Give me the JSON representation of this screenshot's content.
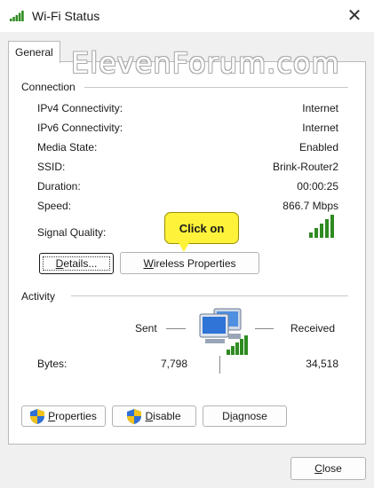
{
  "window": {
    "title": "Wi-Fi Status",
    "close_glyph": "✕"
  },
  "tabs": [
    {
      "label": "General"
    }
  ],
  "watermark": "ElevenForum.com",
  "connection": {
    "heading": "Connection",
    "rows": [
      {
        "label": "IPv4 Connectivity:",
        "value": "Internet"
      },
      {
        "label": "IPv6 Connectivity:",
        "value": "Internet"
      },
      {
        "label": "Media State:",
        "value": "Enabled"
      },
      {
        "label": "SSID:",
        "value": "Brink-Router2"
      },
      {
        "label": "Duration:",
        "value": "00:00:25"
      },
      {
        "label": "Speed:",
        "value": "866.7 Mbps"
      }
    ],
    "signal_label": "Signal Quality:",
    "signal_bars_filled": 5,
    "details_button": "Details...",
    "wireless_button": "Wireless Properties"
  },
  "callout": {
    "text": "Click on",
    "color": "#fff23a"
  },
  "activity": {
    "heading": "Activity",
    "sent_label": "Sent",
    "received_label": "Received",
    "bytes_label": "Bytes:",
    "bytes_sent": "7,798",
    "bytes_received": "34,518"
  },
  "actions": {
    "properties": "Properties",
    "disable": "Disable",
    "diagnose": "Diagnose"
  },
  "footer": {
    "close": "Close"
  },
  "colors": {
    "signal": "#2e8b20",
    "callout": "#fff23a",
    "shield_blue": "#2f6fd6",
    "shield_yellow": "#f2c21b"
  }
}
